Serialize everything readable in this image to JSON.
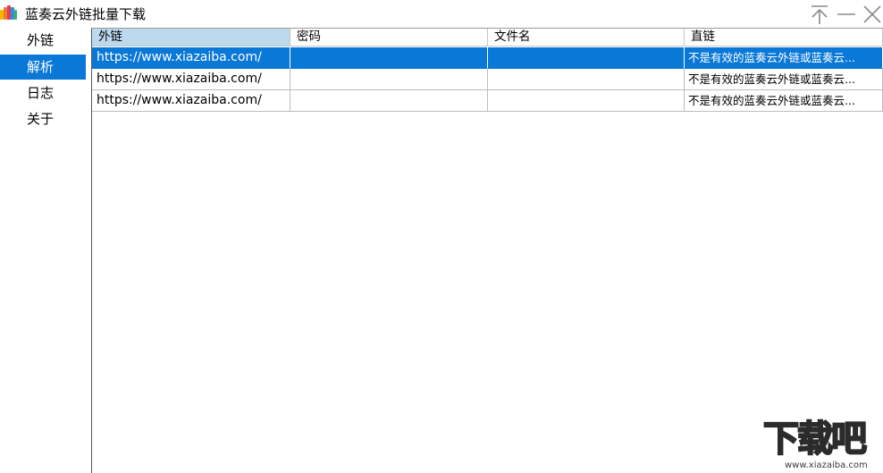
{
  "window": {
    "title": "蓝奏云外链批量下载",
    "icon": "colorful-bars-app-icon"
  },
  "controls": {
    "pin": "pin-icon",
    "minimize": "minimize-icon",
    "close": "close-icon"
  },
  "sidebar": {
    "items": [
      {
        "label": "外链",
        "active": false
      },
      {
        "label": "解析",
        "active": true
      },
      {
        "label": "日志",
        "active": false
      },
      {
        "label": "关于",
        "active": false
      }
    ]
  },
  "table": {
    "columns": [
      "外链",
      "密码",
      "文件名",
      "直链"
    ],
    "rows": [
      {
        "link": "https://www.xiazaiba.com/",
        "password": "",
        "filename": "",
        "direct": "不是有效的蓝奏云外链或蓝奏云...",
        "selected": true
      },
      {
        "link": "https://www.xiazaiba.com/",
        "password": "",
        "filename": "",
        "direct": "不是有效的蓝奏云外链或蓝奏云...",
        "selected": false
      },
      {
        "link": "https://www.xiazaiba.com/",
        "password": "",
        "filename": "",
        "direct": "不是有效的蓝奏云外链或蓝奏云...",
        "selected": false
      }
    ]
  },
  "watermark": {
    "big": "下载吧",
    "small": "www.xiazaiba.com"
  },
  "colors": {
    "accent": "#0a78d7",
    "header_sorted": "#bcd9ee"
  }
}
